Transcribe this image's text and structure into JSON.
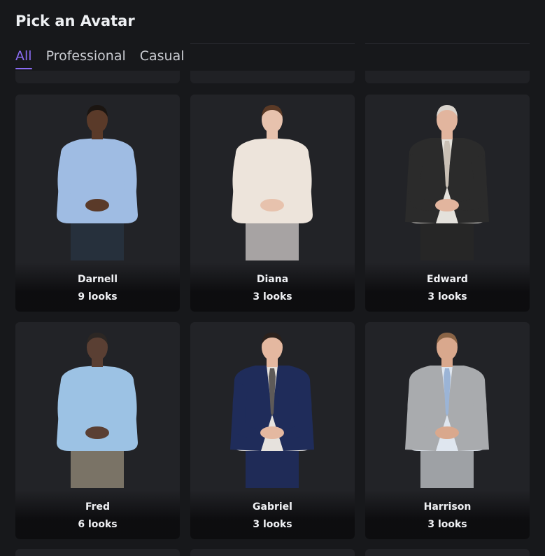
{
  "page": {
    "title": "Pick an Avatar"
  },
  "tabs": [
    {
      "label": "All",
      "active": true
    },
    {
      "label": "Professional",
      "active": false
    },
    {
      "label": "Casual",
      "active": false
    }
  ],
  "avatars": [
    {
      "name": "Darnell",
      "looks": "9 looks",
      "skin": "#5a3a29",
      "hair": "#1b1511",
      "top": "#9fbce3",
      "jacket": null,
      "tie": null,
      "pants": "#26303c"
    },
    {
      "name": "Diana",
      "looks": "3 looks",
      "skin": "#e7c2ad",
      "hair": "#5b3a26",
      "top": "#ede4db",
      "jacket": null,
      "tie": null,
      "pants": "#a7a3a3"
    },
    {
      "name": "Edward",
      "looks": "3 looks",
      "skin": "#e2b59e",
      "hair": "#d9d3cc",
      "top": "#e4e1db",
      "jacket": "#2b2b2b",
      "tie": "#c9c0b5",
      "pants": "#262626"
    },
    {
      "name": "Fred",
      "looks": "6 looks",
      "skin": "#5a3f33",
      "hair": "#2c2724",
      "top": "#9cc2e4",
      "jacket": null,
      "tie": null,
      "pants": "#7a7366"
    },
    {
      "name": "Gabriel",
      "looks": "3 looks",
      "skin": "#e4b8a0",
      "hair": "#2b211c",
      "top": "#e6e2dd",
      "jacket": "#1f2c5a",
      "tie": "#5e5a58",
      "pants": "#1f2b57"
    },
    {
      "name": "Harrison",
      "looks": "3 looks",
      "skin": "#d9a88d",
      "hair": "#8a6446",
      "top": "#dfe6ef",
      "jacket": "#a9abae",
      "tie": "#9bb4d6",
      "pants": "#9ea1a5"
    }
  ]
}
